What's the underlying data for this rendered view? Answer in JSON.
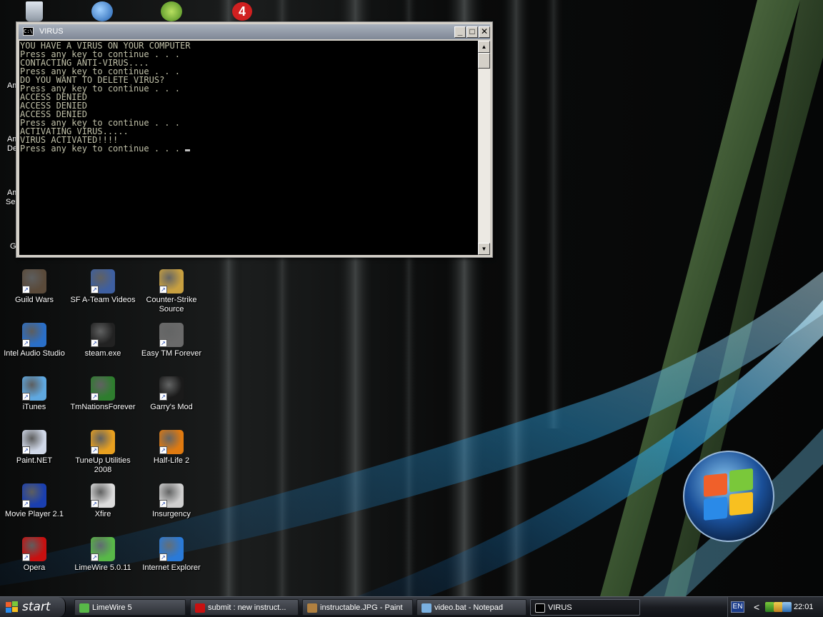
{
  "console_window": {
    "title": "VIRUS",
    "title_icon_text": "C:\\",
    "lines": [
      "YOU HAVE A VIRUS ON YOUR COMPUTER",
      "Press any key to continue . . .",
      "CONTACTING ANTI-VIRUS....",
      "Press any key to continue . . .",
      "DO YOU WANT TO DELETE VIRUS?",
      "Press any key to continue . . .",
      "ACCESS DENIED",
      "ACCESS DENIED",
      "ACCESS DENIED",
      "Press any key to continue . . .",
      "ACTIVATING VIRUS.....",
      "VIRUS ACTIVATED!!!!",
      "Press any key to continue . . . "
    ],
    "minimize_glyph": "_",
    "maximize_glyph": "□",
    "close_glyph": "✕",
    "scroll_up_glyph": "▲",
    "scroll_down_glyph": "▼",
    "text_color": "#c0c0a8"
  },
  "desktop": {
    "partial_labels": [
      "Am",
      "Am",
      "De",
      "Am",
      "Ser",
      "G"
    ],
    "icons": [
      {
        "label": "Guild Wars",
        "icon": "guild-wars-icon",
        "color": "#5a4a3a"
      },
      {
        "label": "SF A-Team Videos",
        "icon": "folder-video-icon",
        "color": "#3e5fa0"
      },
      {
        "label": "Counter-Strike Source",
        "icon": "counter-strike-icon",
        "color": "#c8a040"
      },
      {
        "label": "Intel Audio Studio",
        "icon": "audio-studio-icon",
        "color": "#2a6fc8"
      },
      {
        "label": "steam.exe",
        "icon": "steam-icon",
        "color": "#222222"
      },
      {
        "label": "Easy TM Forever",
        "icon": "easy-tm-icon",
        "color": "#6a6a6a"
      },
      {
        "label": "iTunes",
        "icon": "itunes-icon",
        "color": "#5fa8e0"
      },
      {
        "label": "TmNationsForever",
        "icon": "tmnations-icon",
        "color": "#2e7d2e"
      },
      {
        "label": "Garry's Mod",
        "icon": "garrys-mod-icon",
        "color": "#1a1a1a"
      },
      {
        "label": "Paint.NET",
        "icon": "paint-net-icon",
        "color": "#d0d8e8"
      },
      {
        "label": "TuneUp Utilities 2008",
        "icon": "tuneup-icon",
        "color": "#e8a020"
      },
      {
        "label": "Half-Life 2",
        "icon": "half-life-icon",
        "color": "#e07a10"
      },
      {
        "label": "Movie Player 2.1",
        "icon": "movie-player-icon",
        "color": "#1a3fb0"
      },
      {
        "label": "Xfire",
        "icon": "xfire-icon",
        "color": "#dcdcdc"
      },
      {
        "label": "Insurgency",
        "icon": "insurgency-icon",
        "color": "#cfcfcf"
      },
      {
        "label": "Opera",
        "icon": "opera-icon",
        "color": "#c81010"
      },
      {
        "label": "LimeWire 5.0.11",
        "icon": "limewire-icon",
        "color": "#58b848"
      },
      {
        "label": "Internet Explorer",
        "icon": "internet-explorer-icon",
        "color": "#2a7ad8"
      }
    ],
    "top_partial_icons": [
      {
        "icon": "recycle-bin-icon",
        "color": "#b8c0c8"
      },
      {
        "icon": "media-player-icon",
        "color": "#3a8ad8"
      },
      {
        "icon": "limewire-icon",
        "color": "#7ab840"
      },
      {
        "icon": "channel-4-icon",
        "color": "#d02020",
        "text": "4"
      }
    ]
  },
  "taskbar": {
    "start_label": "start",
    "tasks": [
      {
        "label": "LimeWire 5",
        "icon": "limewire-icon",
        "color": "#58b848",
        "active": false
      },
      {
        "label": "submit : new instruct...",
        "icon": "opera-icon",
        "color": "#c81010",
        "active": false
      },
      {
        "label": "instructable.JPG - Paint",
        "icon": "paint-icon",
        "color": "#b08040",
        "active": false
      },
      {
        "label": "video.bat - Notepad",
        "icon": "notepad-icon",
        "color": "#7ab0e0",
        "active": false
      },
      {
        "label": "VIRUS",
        "icon": "console-icon",
        "color": "#000000",
        "active": true
      }
    ],
    "language": "EN",
    "tray_chevron": "<",
    "clock": "22:01"
  }
}
